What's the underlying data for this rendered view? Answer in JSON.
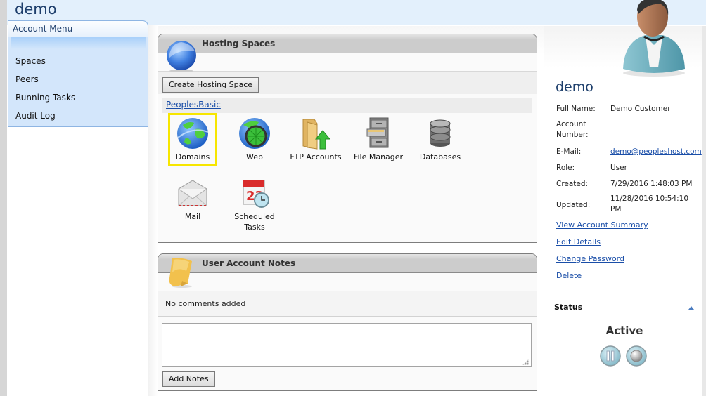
{
  "header": {
    "title": "demo"
  },
  "sidebar": {
    "title": "Account Menu",
    "items": [
      {
        "label": "Spaces"
      },
      {
        "label": "Peers"
      },
      {
        "label": "Running Tasks"
      },
      {
        "label": "Audit Log"
      }
    ]
  },
  "hosting_spaces": {
    "title": "Hosting Spaces",
    "create_button": "Create Hosting Space",
    "space_name": "PeoplesBasic",
    "tiles": [
      {
        "label": "Domains",
        "icon": "globe-icon",
        "selected": true
      },
      {
        "label": "Web",
        "icon": "web-globe-icon"
      },
      {
        "label": "FTP Accounts",
        "icon": "folder-upload-icon"
      },
      {
        "label": "File Manager",
        "icon": "file-cabinet-icon"
      },
      {
        "label": "Databases",
        "icon": "database-icon"
      },
      {
        "label": "Mail",
        "icon": "envelope-icon"
      },
      {
        "label": "Scheduled Tasks",
        "icon": "calendar-clock-icon"
      }
    ]
  },
  "notes": {
    "title": "User Account Notes",
    "empty_text": "No comments added",
    "textarea_value": "",
    "add_button": "Add Notes"
  },
  "user": {
    "name": "demo",
    "fields": [
      {
        "label": "Full Name:",
        "value": "Demo Customer"
      },
      {
        "label": "Account Number:",
        "value": ""
      },
      {
        "label": "E-Mail:",
        "value": "demo@peopleshost.com",
        "link": true
      },
      {
        "label": "Role:",
        "value": "User"
      },
      {
        "label": "Created:",
        "value": "7/29/2016 1:48:03 PM"
      },
      {
        "label": "Updated:",
        "value": "11/28/2016 10:54:10 PM"
      }
    ],
    "actions": [
      {
        "label": "View Account Summary"
      },
      {
        "label": "Edit Details"
      },
      {
        "label": "Change Password"
      },
      {
        "label": "Delete"
      }
    ]
  },
  "status": {
    "heading": "Status",
    "value": "Active",
    "buttons": [
      {
        "name": "pause"
      },
      {
        "name": "stop"
      }
    ]
  },
  "colors": {
    "header_bg": "#e3f0fc",
    "title_text": "#1e3f6c",
    "link": "#1a4ea8",
    "sidebar_bg": "#d3e6fb",
    "selection_highlight": "#f7e600"
  }
}
